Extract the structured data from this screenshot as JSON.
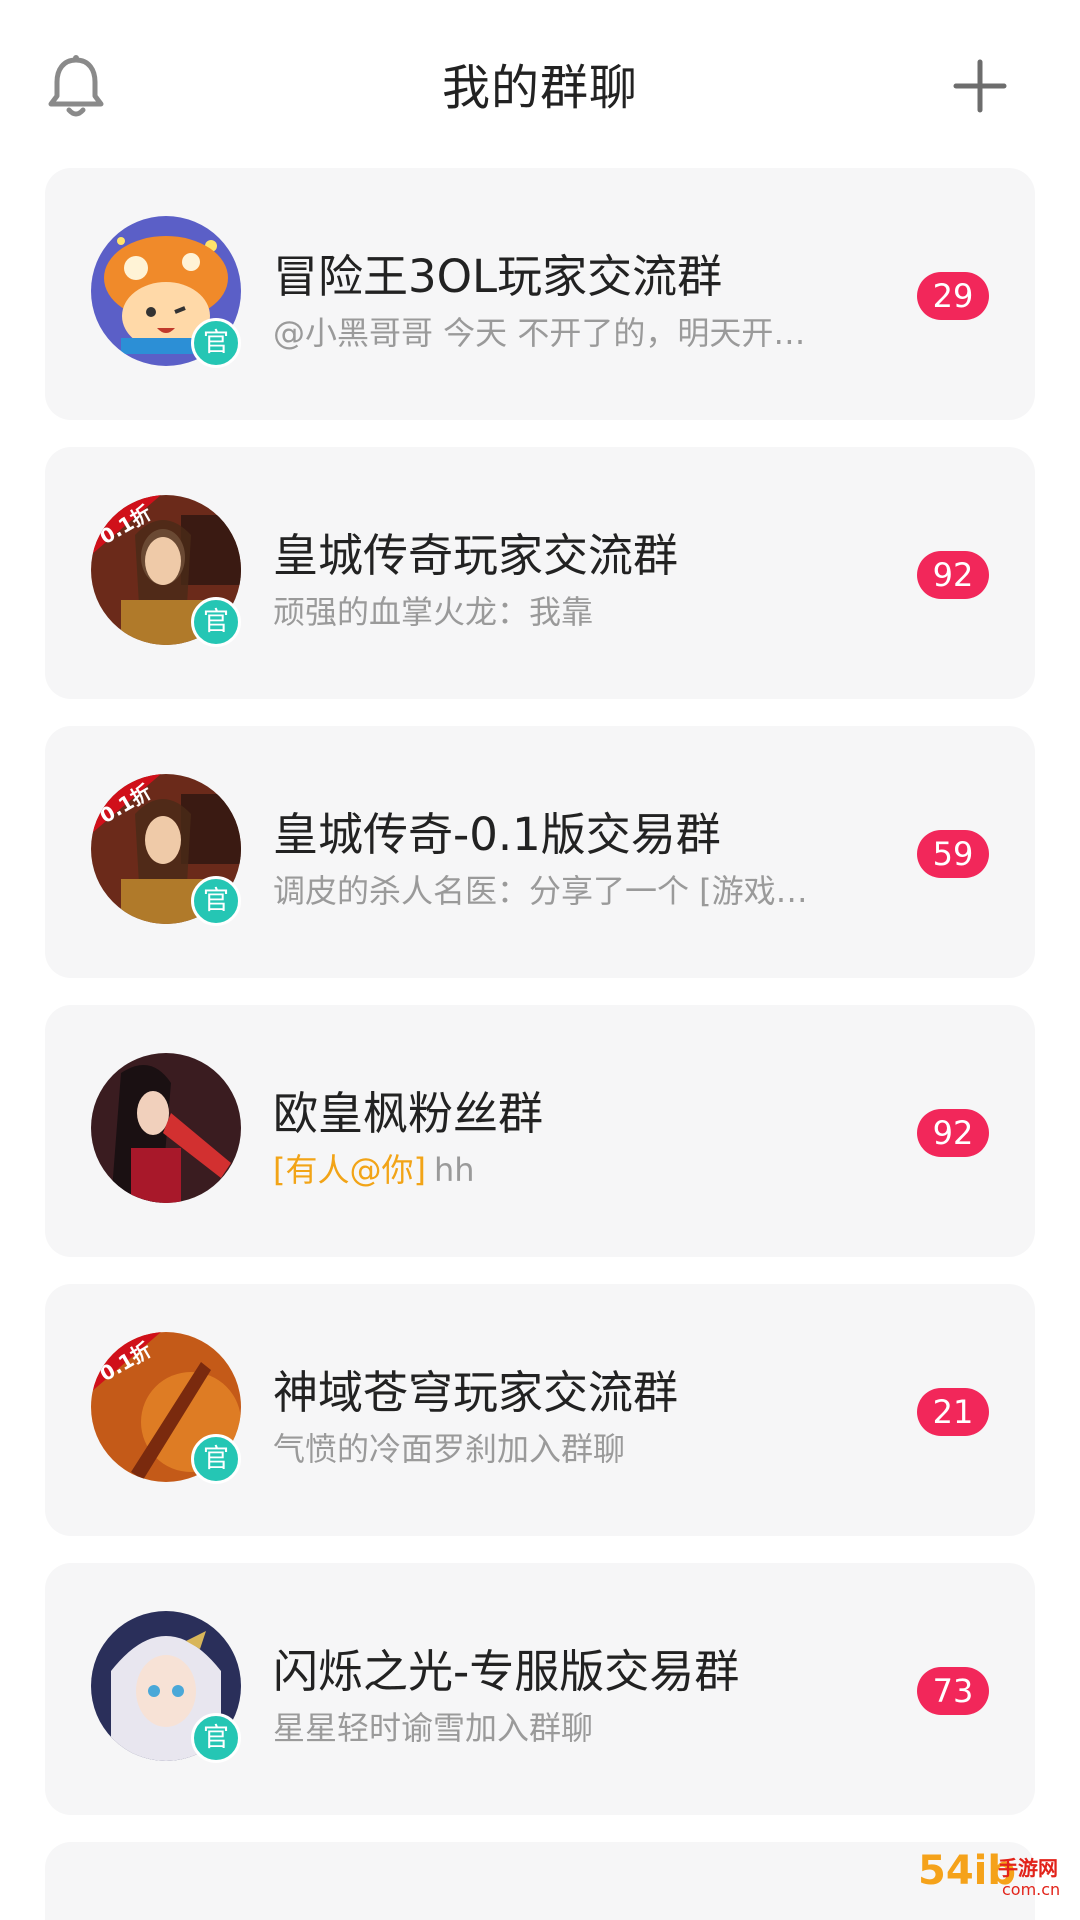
{
  "header": {
    "title": "我的群聊"
  },
  "icons": {
    "bell": "bell-icon",
    "plus": "plus-icon"
  },
  "colors": {
    "badge": "#f2275a",
    "official": "#25c6b4",
    "mention": "#f2a417",
    "card_bg": "#f6f6f7"
  },
  "groups": [
    {
      "name": "冒险王3OL玩家交流群",
      "preview": "@小黑哥哥 今天 不开了的，明天开…",
      "mention": "",
      "unread": "29",
      "official_label": "官"
    },
    {
      "name": "皇城传奇玩家交流群",
      "preview": "顽强的血掌火龙：我靠",
      "mention": "",
      "unread": "92",
      "avatar_tag": "0.1折",
      "official_label": "官"
    },
    {
      "name": "皇城传奇-0.1版交易群",
      "preview": "调皮的杀人名医：分享了一个 [游戏…",
      "mention": "",
      "unread": "59",
      "avatar_tag": "0.1折",
      "official_label": "官"
    },
    {
      "name": "欧皇枫粉丝群",
      "preview": "hh",
      "mention": "[有人@你]",
      "unread": "92"
    },
    {
      "name": "神域苍穹玩家交流群",
      "preview": "气愤的冷面罗刹加入群聊",
      "mention": "",
      "unread": "21",
      "avatar_tag": "0.1折",
      "official_label": "官"
    },
    {
      "name": "闪烁之光-专服版交易群",
      "preview": "星星轻时谕雪加入群聊",
      "mention": "",
      "unread": "73",
      "official_label": "官"
    }
  ],
  "watermark": {
    "main": "54ib",
    "side": "手游网",
    "domain": "com.cn"
  }
}
